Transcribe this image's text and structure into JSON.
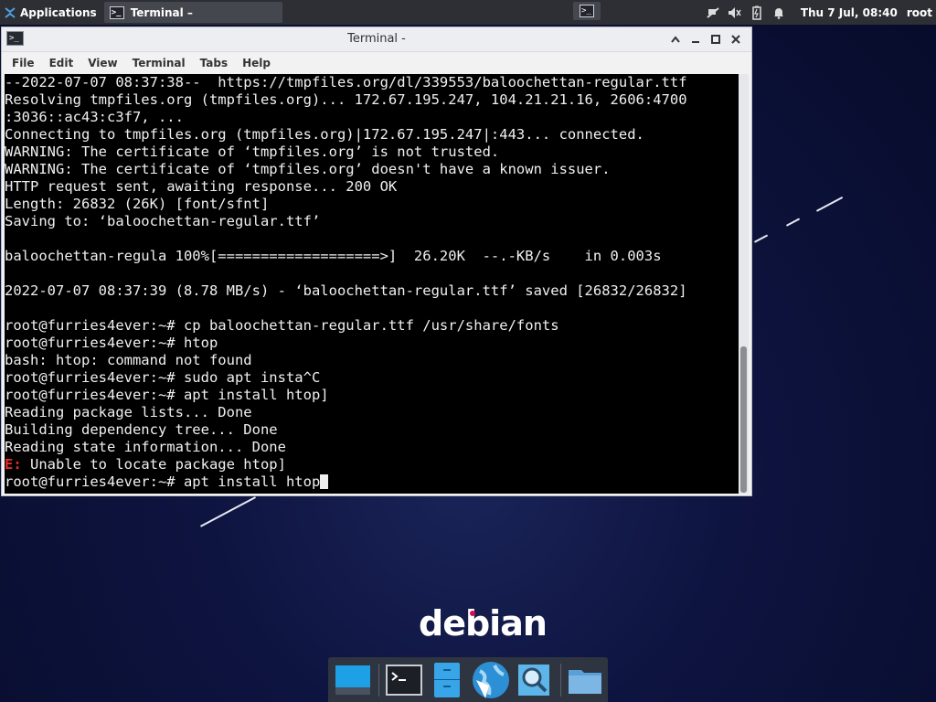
{
  "panel": {
    "applications_label": "Applications",
    "task_label": "Terminal –",
    "clock": "Thu 7 Jul, 08:40",
    "user": "root"
  },
  "window": {
    "title": "Terminal -",
    "menu": [
      "File",
      "Edit",
      "View",
      "Terminal",
      "Tabs",
      "Help"
    ]
  },
  "terminal": {
    "lines": [
      "--2022-07-07 08:37:38--  https://tmpfiles.org/dl/339553/baloochettan-regular.ttf",
      "Resolving tmpfiles.org (tmpfiles.org)... 172.67.195.247, 104.21.21.16, 2606:4700",
      ":3036::ac43:c3f7, ...",
      "Connecting to tmpfiles.org (tmpfiles.org)|172.67.195.247|:443... connected.",
      "WARNING: The certificate of ‘tmpfiles.org’ is not trusted.",
      "WARNING: The certificate of ‘tmpfiles.org’ doesn't have a known issuer.",
      "HTTP request sent, awaiting response... 200 OK",
      "Length: 26832 (26K) [font/sfnt]",
      "Saving to: ‘baloochettan-regular.ttf’",
      "",
      "baloochettan-regula 100%[===================>]  26.20K  --.-KB/s    in 0.003s",
      "",
      "2022-07-07 08:37:39 (8.78 MB/s) - ‘baloochettan-regular.ttf’ saved [26832/26832]",
      "",
      "root@furries4ever:~# cp baloochettan-regular.ttf /usr/share/fonts",
      "root@furries4ever:~# htop",
      "bash: htop: command not found",
      "root@furries4ever:~# sudo apt insta^C",
      "root@furries4ever:~# apt install htop]",
      "Reading package lists... Done",
      "Building dependency tree... Done",
      "Reading state information... Done"
    ],
    "error_prefix": "E:",
    "error_text": " Unable to locate package htop]",
    "current_prompt": "root@furries4ever:~# apt install htop"
  },
  "desktop": {
    "logo": "debian"
  },
  "dock": {
    "icons": [
      "desktop-icon",
      "terminal-icon",
      "file-manager-icon",
      "web-browser-icon",
      "search-icon",
      "folder-icon"
    ]
  }
}
